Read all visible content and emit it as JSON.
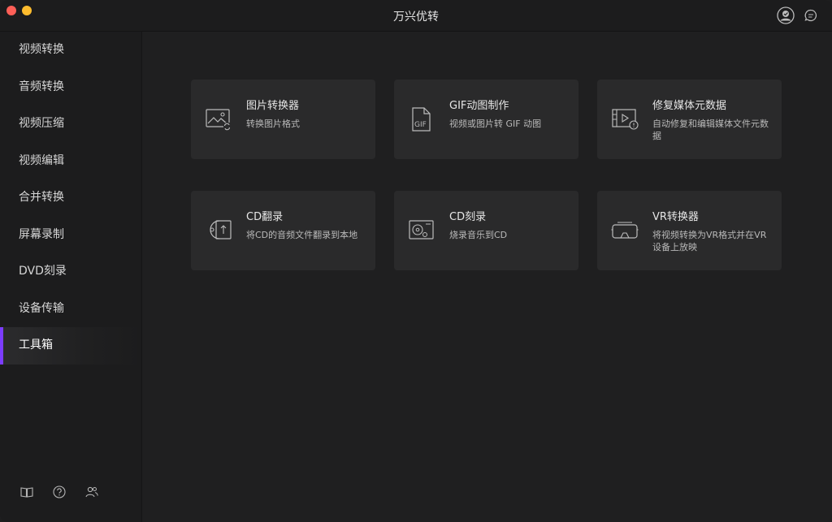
{
  "window": {
    "title": "万兴优转"
  },
  "sidebar": {
    "items": [
      {
        "label": "视频转换"
      },
      {
        "label": "音频转换"
      },
      {
        "label": "视频压缩"
      },
      {
        "label": "视频编辑"
      },
      {
        "label": "合并转换"
      },
      {
        "label": "屏幕录制"
      },
      {
        "label": "DVD刻录"
      },
      {
        "label": "设备传输"
      },
      {
        "label": "工具箱",
        "active": true
      }
    ],
    "bottom_icons": [
      "book-icon",
      "help-icon",
      "users-icon"
    ]
  },
  "toolbox": {
    "cards": [
      {
        "title": "图片转换器",
        "desc": "转换图片格式",
        "icon": "image-convert-icon"
      },
      {
        "title": "GIF动图制作",
        "desc": "视频或图片转 GIF 动图",
        "icon": "gif-file-icon"
      },
      {
        "title": "修复媒体元数据",
        "desc": "自动修复和编辑媒体文件元数据",
        "icon": "media-metadata-icon"
      },
      {
        "title": "CD翻录",
        "desc": "将CD的音频文件翻录到本地",
        "icon": "cd-rip-icon"
      },
      {
        "title": "CD刻录",
        "desc": "烧录音乐到CD",
        "icon": "cd-burn-icon"
      },
      {
        "title": "VR转换器",
        "desc": "将视频转换为VR格式并在VR设备上放映",
        "icon": "vr-headset-icon"
      }
    ]
  },
  "colors": {
    "accent": "#7c3cff",
    "window_bg": "#1e1e1f",
    "card_bg": "#2a2a2b"
  }
}
